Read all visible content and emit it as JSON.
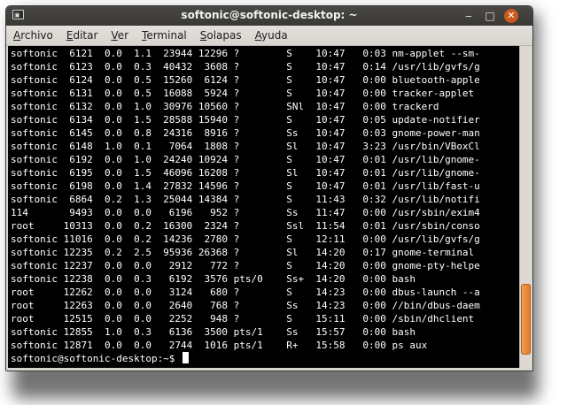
{
  "window": {
    "title": "softonic@softonic-desktop: ~",
    "app_icon_glyph": "▣",
    "controls": {
      "minimize": "‒",
      "maximize": "□",
      "close": "✕"
    }
  },
  "menu": [
    "Archivo",
    "Editar",
    "Ver",
    "Terminal",
    "Solapas",
    "Ayuda"
  ],
  "terminal": {
    "lines": [
      "softonic  6121  0.0  1.1  23944 12296 ?        S    10:47   0:03 nm-applet --sm-",
      "softonic  6123  0.0  0.3  40432  3608 ?        S    10:47   0:14 /usr/lib/gvfs/g",
      "softonic  6124  0.0  0.5  15260  6124 ?        S    10:47   0:00 bluetooth-apple",
      "softonic  6131  0.0  0.5  16088  5924 ?        S    10:47   0:00 tracker-applet",
      "softonic  6132  0.0  1.0  30976 10560 ?        SNl  10:47   0:00 trackerd",
      "softonic  6134  0.0  1.5  28588 15940 ?        S    10:47   0:05 update-notifier",
      "softonic  6145  0.0  0.8  24316  8916 ?        Ss   10:47   0:03 gnome-power-man",
      "softonic  6148  1.0  0.1   7064  1808 ?        Sl   10:47   3:23 /usr/bin/VBoxCl",
      "softonic  6192  0.0  1.0  24240 10924 ?        S    10:47   0:01 /usr/lib/gnome-",
      "softonic  6195  0.0  1.5  46096 16208 ?        Sl   10:47   0:01 /usr/lib/gnome-",
      "softonic  6198  0.0  1.4  27832 14596 ?        S    10:47   0:01 /usr/lib/fast-u",
      "softonic  6864  0.2  1.3  25044 14384 ?        S    11:43   0:32 /usr/lib/notifi",
      "114       9493  0.0  0.0   6196   952 ?        Ss   11:47   0:00 /usr/sbin/exim4",
      "root     10313  0.0  0.2  16300  2324 ?        Ssl  11:54   0:01 /usr/sbin/conso",
      "softonic 11016  0.0  0.2  14236  2780 ?        S    12:11   0:00 /usr/lib/gvfs/g",
      "softonic 12235  0.2  2.5  95936 26368 ?        Sl   14:20   0:17 gnome-terminal",
      "softonic 12237  0.0  0.0   2912   772 ?        S    14:20   0:00 gnome-pty-helpe",
      "softonic 12238  0.0  0.3   6192  3576 pts/0    Ss+  14:20   0:00 bash",
      "root     12262  0.0  0.0   3124   680 ?        S    14:23   0:00 dbus-launch --a",
      "root     12263  0.0  0.0   2640   768 ?        Ss   14:23   0:00 //bin/dbus-daem",
      "root     12515  0.0  0.0   2252   948 ?        S    15:11   0:00 /sbin/dhclient",
      "softonic 12855  1.0  0.3   6136  3500 pts/1    Ss   15:57   0:00 bash",
      "softonic 12871  0.0  0.0   2744  1016 pts/1    R+   15:58   0:00 ps aux"
    ],
    "prompt": "softonic@softonic-desktop:~$ "
  },
  "scroll_position": 0.96
}
